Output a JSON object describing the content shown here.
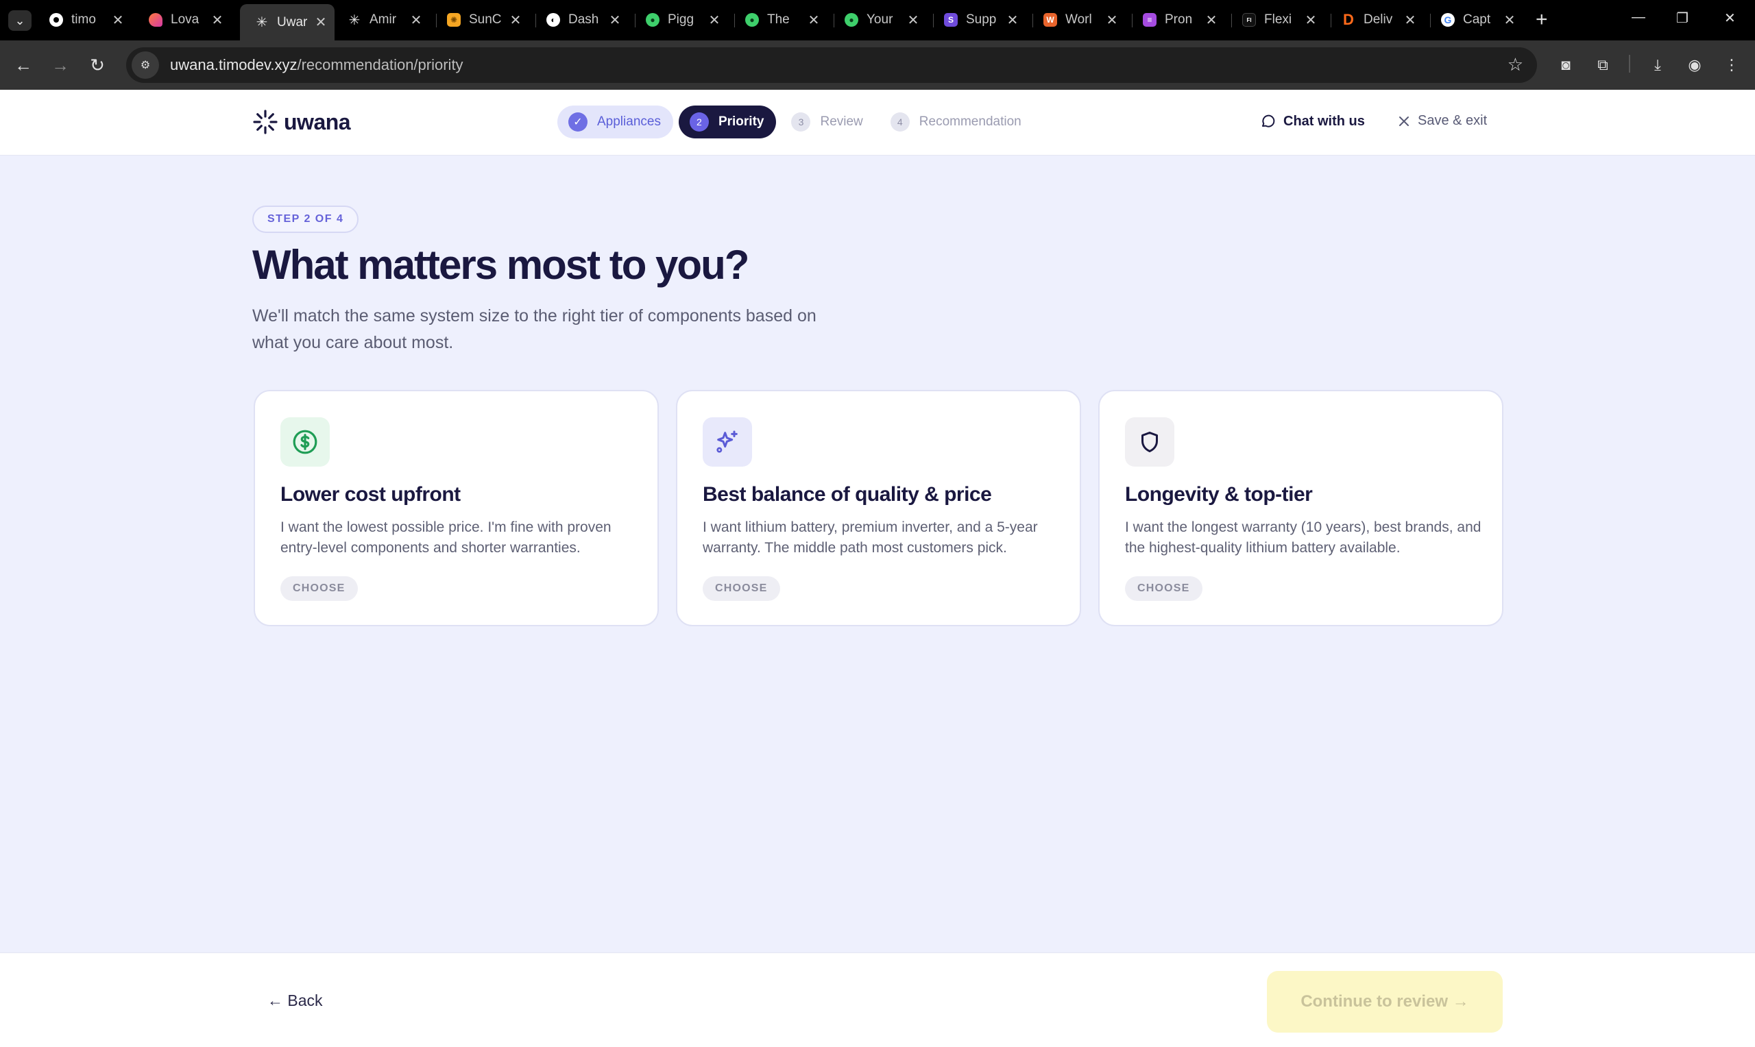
{
  "browser": {
    "tabs": [
      {
        "title": "timo",
        "favicon_color": "#ffffff"
      },
      {
        "title": "Lova",
        "favicon_color": "#e4508a"
      },
      {
        "title": "Uwar",
        "favicon_color": "#ffffff"
      },
      {
        "title": "Amir",
        "favicon_color": "#ffffff"
      },
      {
        "title": "SunC",
        "favicon_color": "#f5a623"
      },
      {
        "title": "Dash",
        "favicon_color": "#ffffff"
      },
      {
        "title": "Pigg",
        "favicon_color": "#3ecf6b"
      },
      {
        "title": "The",
        "favicon_color": "#3ecf6b"
      },
      {
        "title": "Your",
        "favicon_color": "#3ecf6b"
      },
      {
        "title": "Supp",
        "favicon_color": "#6f4bdb"
      },
      {
        "title": "Worl",
        "favicon_color": "#e8642c"
      },
      {
        "title": "Pron",
        "favicon_color": "#a54be0"
      },
      {
        "title": "Flexi",
        "favicon_color": "#111111"
      },
      {
        "title": "Deliv",
        "favicon_color": "#ff6a1a"
      },
      {
        "title": "Capt",
        "favicon_color": "#ffffff"
      }
    ],
    "active_tab_index": 2,
    "url_host": "uwana.timodev.xyz",
    "url_path": "/recommendation/priority"
  },
  "header": {
    "logo_text": "uwana",
    "steps": [
      {
        "number": "✓",
        "label": "Appliances",
        "state": "done"
      },
      {
        "number": "2",
        "label": "Priority",
        "state": "current"
      },
      {
        "number": "3",
        "label": "Review",
        "state": "todo"
      },
      {
        "number": "4",
        "label": "Recommendation",
        "state": "todo"
      }
    ],
    "chat_label": "Chat with us",
    "exit_label": "Save & exit"
  },
  "main": {
    "step_badge": "STEP 2 OF 4",
    "headline": "What matters most to you?",
    "subtitle": "We'll match the same system size to the right tier of components based on what you care about most.",
    "cards": [
      {
        "icon": "dollar-icon",
        "icon_color": "#1f9d55",
        "icon_bg": "#e7f7ec",
        "title": "Lower cost upfront",
        "description": "I want the lowest possible price. I'm fine with proven entry-level components and shorter warranties.",
        "choose_label": "CHOOSE"
      },
      {
        "icon": "sparkles-icon",
        "icon_color": "#5b5bd6",
        "icon_bg": "#e8e9fb",
        "title": "Best balance of quality & price",
        "description": "I want lithium battery, premium inverter, and a 5-year warranty. The middle path most customers pick.",
        "choose_label": "CHOOSE"
      },
      {
        "icon": "shield-icon",
        "icon_color": "#1a1840",
        "icon_bg": "#f1f0f3",
        "title": "Longevity & top-tier",
        "description": "I want the longest warranty (10 years), best brands, and the highest-quality lithium battery available.",
        "choose_label": "CHOOSE"
      }
    ]
  },
  "footer": {
    "back_label": "← Back",
    "continue_label": "Continue to review →"
  },
  "colors": {
    "accent": "#5b5bd6",
    "navy": "#1a1840",
    "page_bg": "#eef0fd",
    "continue_disabled_bg": "#fcf7c6"
  }
}
